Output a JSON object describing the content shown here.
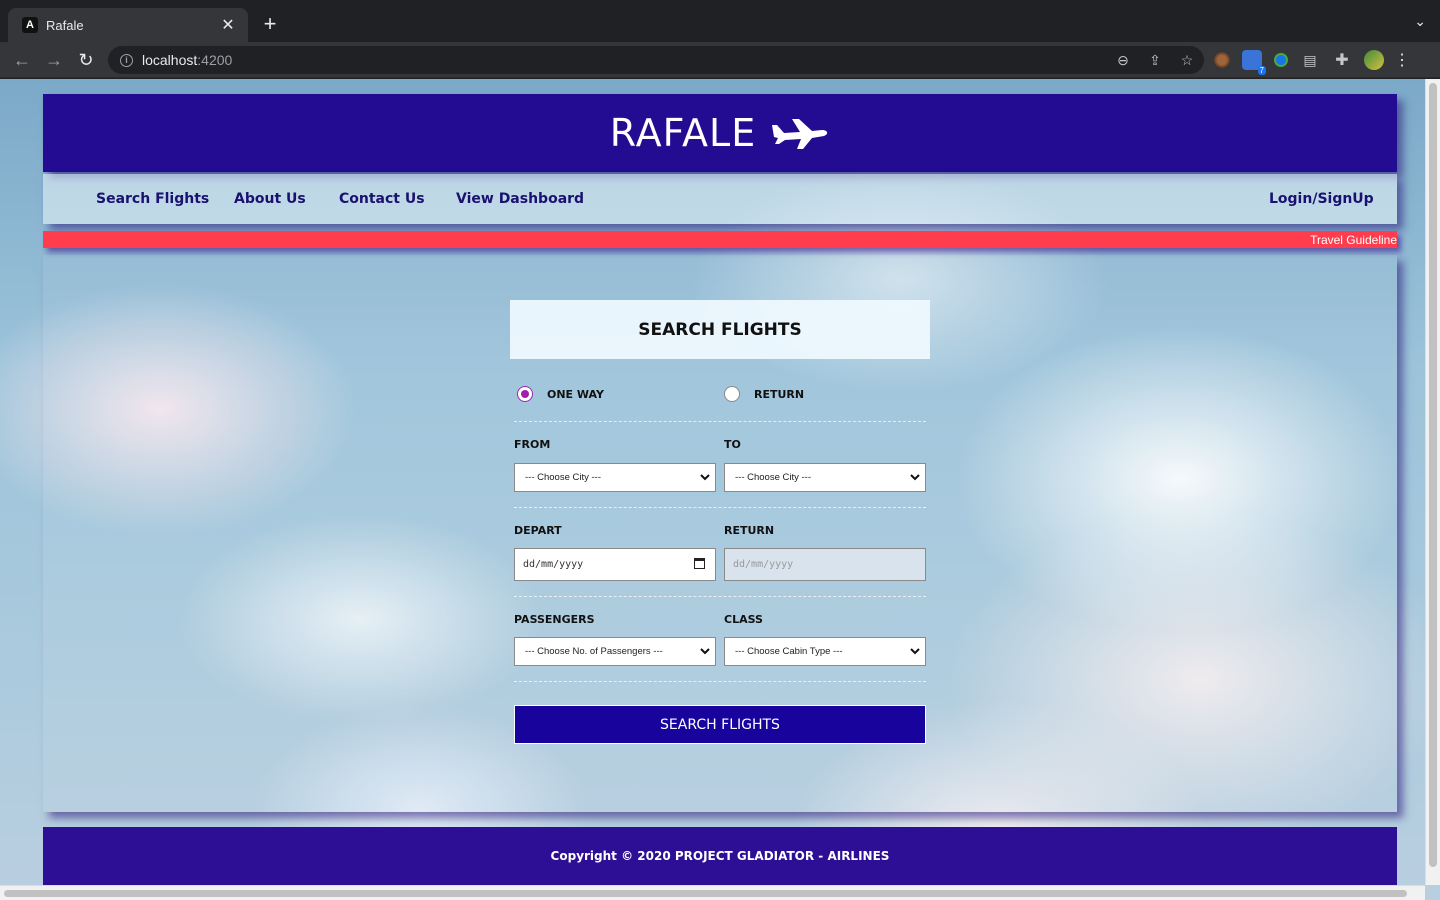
{
  "browser": {
    "tab_title": "Rafale",
    "tab_favicon_letter": "A",
    "url_host": "localhost",
    "url_port": ":4200",
    "extension_badge": "7"
  },
  "header": {
    "logo_text": "RAFALE",
    "logo_icon": "airplane-icon"
  },
  "nav": {
    "items": [
      {
        "label": "Search Flights"
      },
      {
        "label": "About Us"
      },
      {
        "label": "Contact Us"
      },
      {
        "label": "View Dashboard"
      }
    ],
    "login_label": "Login/SignUp"
  },
  "ticker": {
    "text": "Travel Guideline"
  },
  "form": {
    "title": "SEARCH FLIGHTS",
    "trip_types": [
      {
        "label": "ONE WAY",
        "checked": true
      },
      {
        "label": "RETURN",
        "checked": false
      }
    ],
    "from_label": "FROM",
    "from_value": "--- Choose City ---",
    "to_label": "TO",
    "to_value": "--- Choose City ---",
    "depart_label": "DEPART",
    "depart_placeholder": "dd/mm/yyyy",
    "return_label": "RETURN",
    "return_placeholder": "dd/mm/yyyy",
    "passengers_label": "PASSENGERS",
    "passengers_value": "--- Choose No. of Passengers ---",
    "class_label": "CLASS",
    "class_value": "--- Choose Cabin Type ---",
    "submit_label": "SEARCH FLIGHTS"
  },
  "footer": {
    "copyright": "Copyright © 2020 PROJECT GLADIATOR - AIRLINES"
  },
  "colors": {
    "header_bg": "#230c91",
    "nav_text": "#1a1270",
    "ticker_bg": "#ff3d4d",
    "button_bg": "#18039c",
    "footer_bg": "#2d0f95",
    "radio_accent": "#a01fb0"
  }
}
